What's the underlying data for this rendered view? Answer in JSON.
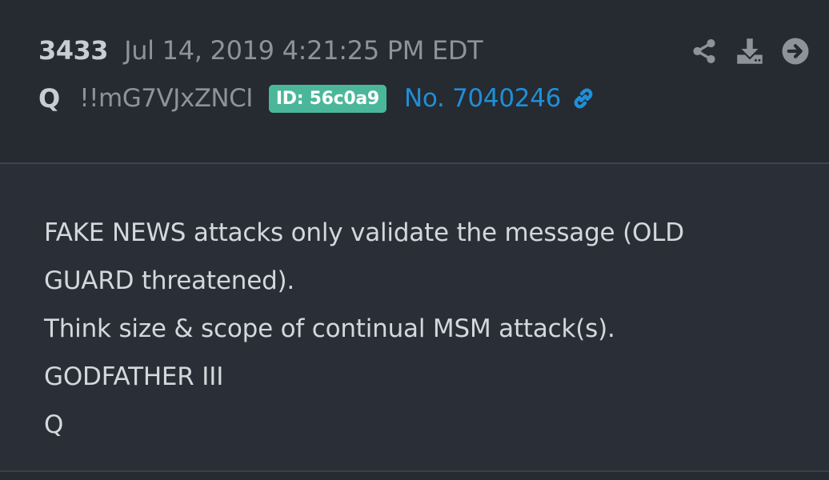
{
  "post": {
    "number": "3433",
    "timestamp": "Jul 14, 2019 4:21:25 PM EDT",
    "author": "Q",
    "tripcode": "!!mG7VJxZNCI",
    "id_badge": "ID: 56c0a9",
    "post_link": "No. 7040246",
    "body_lines": [
      "FAKE NEWS attacks only validate the message (OLD",
      "GUARD threatened).",
      "Think size & scope of continual MSM attack(s).",
      "GODFATHER III",
      "Q"
    ]
  },
  "icons": {
    "share": "share-icon",
    "download": "download-icon",
    "next": "arrow-right-circle-icon",
    "link": "link-icon"
  },
  "colors": {
    "background": "#2a2f37",
    "header_background": "#262a31",
    "badge": "#4bb79a",
    "link": "#1f8fd6",
    "icon": "#8d939b"
  }
}
